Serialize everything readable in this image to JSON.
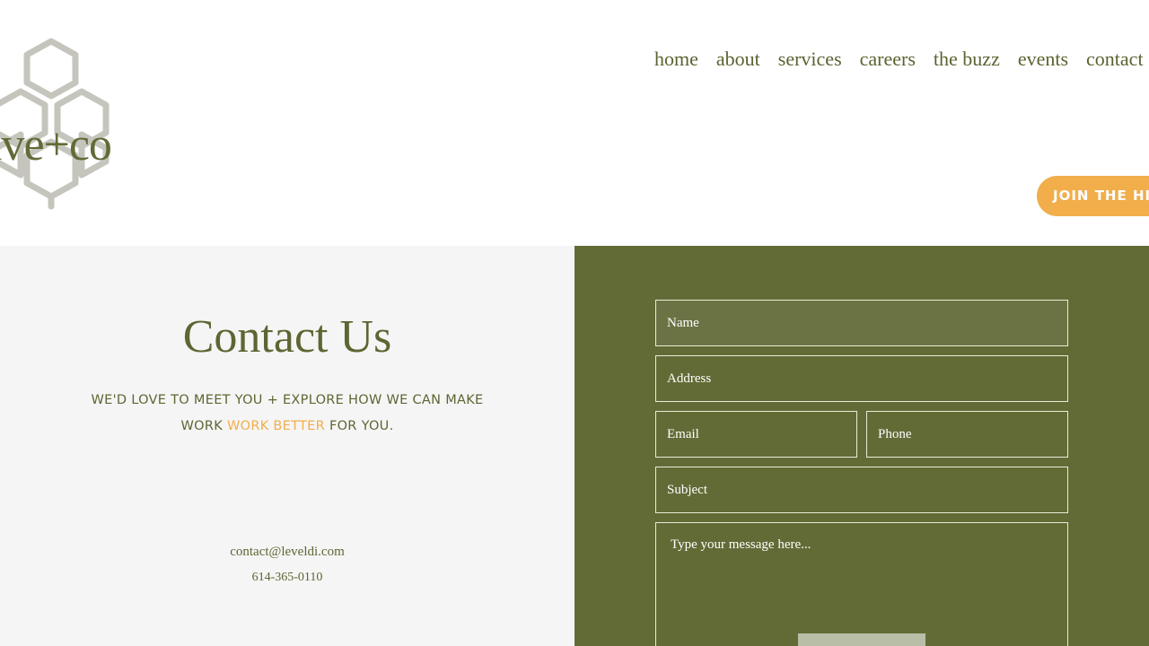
{
  "header": {
    "logo": {
      "text": "ive+co",
      "icon": "honeycomb-logo-icon"
    },
    "nav": [
      "home",
      "about",
      "services",
      "careers",
      "the buzz",
      "events",
      "contact"
    ],
    "cta_label": "JOIN THE HIVE"
  },
  "contact": {
    "title": "Contact Us",
    "tagline_line1": "WE'D LOVE TO MEET YOU + EXPLORE HOW WE CAN MAKE",
    "tagline_pre": "WORK ",
    "tagline_accent": "WORK BETTER",
    "tagline_post": " FOR YOU.",
    "email": "contact@leveldi.com",
    "phone": "614-365-0110"
  },
  "form": {
    "name_placeholder": "Name",
    "address_placeholder": "Address",
    "email_placeholder": "Email",
    "phone_placeholder": "Phone",
    "subject_placeholder": "Subject",
    "message_placeholder": "Type your message here..."
  },
  "colors": {
    "brand_green": "#626b36",
    "accent_orange": "#f1ae4b",
    "panel_gray": "#f5f5f5",
    "logo_gray": "#c5c5bd"
  }
}
